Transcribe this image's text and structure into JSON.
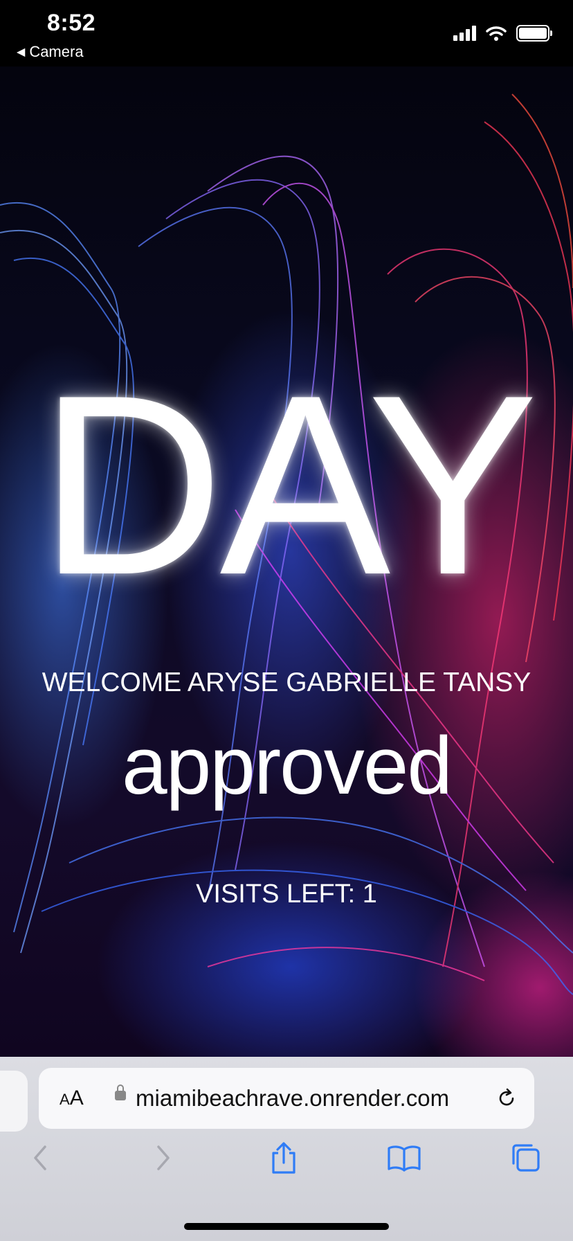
{
  "status_bar": {
    "time": "8:52",
    "back_label": "Camera",
    "icons": [
      "signal-icon",
      "wifi-icon",
      "battery-icon"
    ]
  },
  "hero": {
    "pass_type": "DAY",
    "welcome": "WELCOME ARYSE GABRIELLE TANSY",
    "status": "approved",
    "visits_left": "VISITS LEFT: 1"
  },
  "browser": {
    "text_size_label": "AA",
    "url": "miamibeachrave.onrender.com",
    "toolbar": [
      "back-icon",
      "forward-icon",
      "share-icon",
      "bookmarks-icon",
      "tabs-icon"
    ]
  },
  "colors": {
    "accent_blue": "#3a7bff",
    "accent_pink": "#ff2a7a",
    "toolbar_tint": "#2f7cf6"
  }
}
